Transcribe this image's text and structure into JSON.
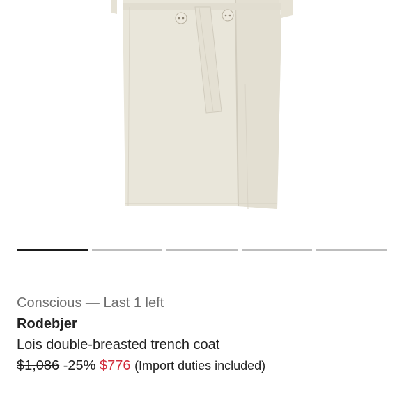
{
  "product": {
    "tagline": "Conscious — Last 1 left",
    "brand": "Rodebjer",
    "name": "Lois double-breasted trench coat",
    "original_price": "$1,086",
    "discount": "-25%",
    "sale_price": "$776",
    "duties_note": "(Import duties included)"
  },
  "carousel": {
    "total_slides": 5,
    "active_index": 0
  },
  "colors": {
    "sale_price": "#d22c3c",
    "coat": "#e9e6da",
    "active_indicator": "#1b1b1b",
    "inactive_indicator": "#bdbdbd"
  }
}
